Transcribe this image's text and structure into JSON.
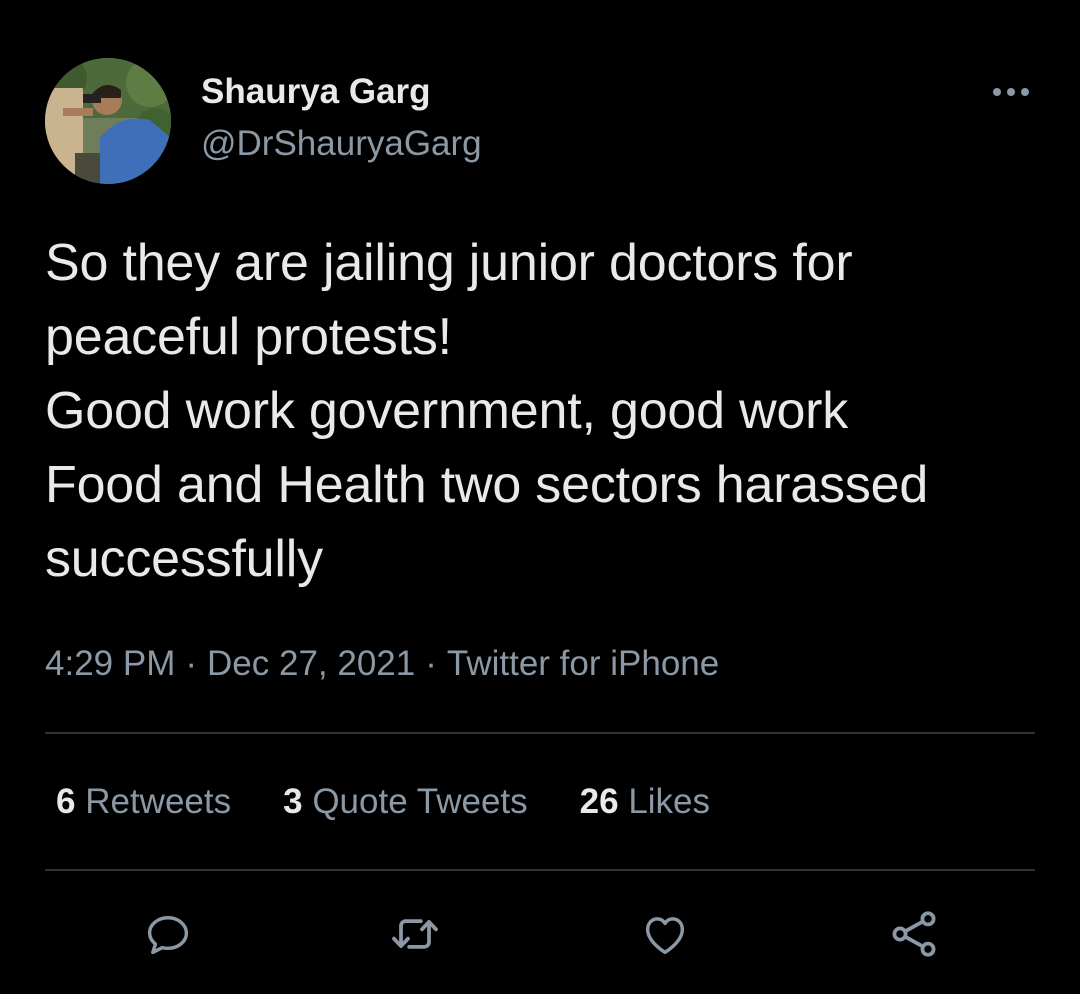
{
  "author": {
    "display_name": "Shaurya Garg",
    "handle": "@DrShauryaGarg",
    "avatar_icon": "profile-photo"
  },
  "tweet": {
    "text": "So they are jailing junior doctors for peaceful protests!\nGood work government, good work\nFood and Health two sectors harassed successfully",
    "time": "4:29 PM",
    "date": "Dec 27, 2021",
    "separator": "·",
    "source": "Twitter for iPhone"
  },
  "stats": {
    "retweets_count": "6",
    "retweets_label": "Retweets",
    "quotes_count": "3",
    "quotes_label": "Quote Tweets",
    "likes_count": "26",
    "likes_label": "Likes"
  },
  "actions": [
    "reply-icon",
    "retweet-icon",
    "like-icon",
    "share-icon"
  ],
  "colors": {
    "background": "#000000",
    "primary_text": "#e7e9ea",
    "secondary_text": "#8b98a5",
    "divider": "#2f3336"
  }
}
